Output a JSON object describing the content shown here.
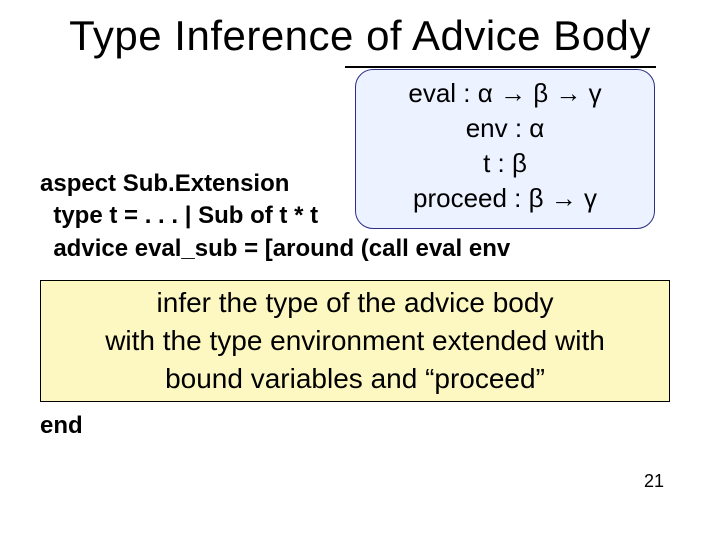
{
  "title": "Type Inference of Advice Body",
  "code": {
    "line1": "aspect Sub.Extension",
    "line2": "  type t = . . . | Sub of t * t",
    "line3": "  advice eval_sub = [around (call eval env"
  },
  "typebox": {
    "l1": "eval : α → β → γ",
    "l2": "env : α",
    "l3": "t : β",
    "l4": "proceed : β → γ"
  },
  "note": {
    "l1": "infer the type of the advice body",
    "l2": "with the type environment extended with",
    "l3": "bound variables and “proceed”"
  },
  "end": "end",
  "page": "21"
}
